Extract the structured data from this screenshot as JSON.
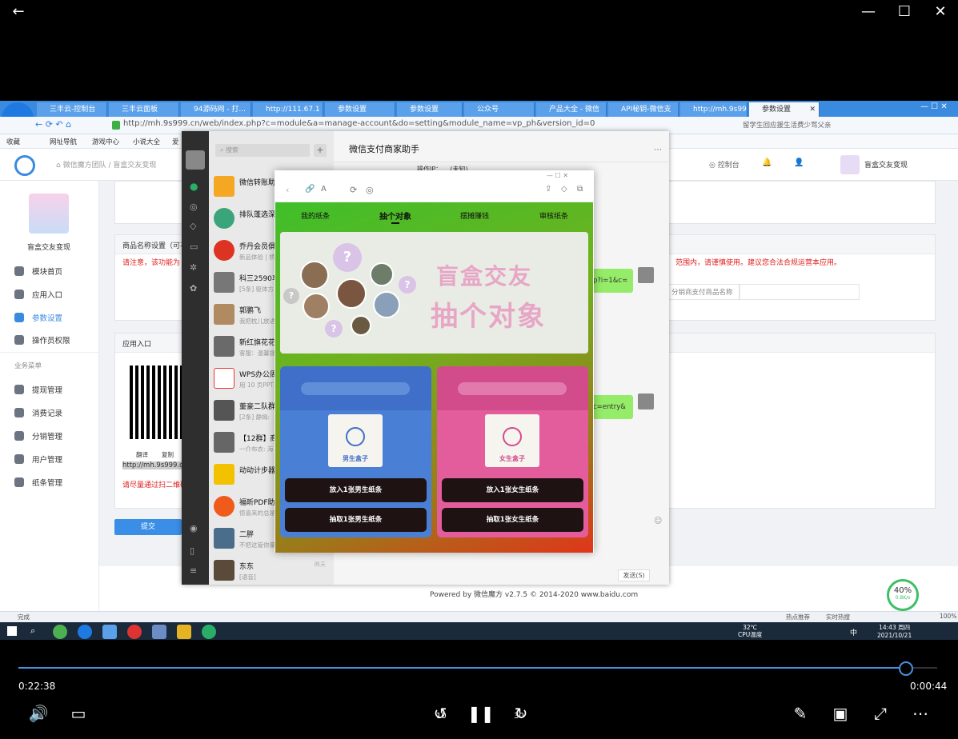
{
  "player": {
    "elapsed": "0:22:38",
    "remaining": "0:00:44",
    "progress": 0.966,
    "rewind_label": "10",
    "forward_label": "30"
  },
  "browser": {
    "tabs": [
      "三丰云-控制台",
      "三丰云面板",
      "94源码网 - 打...",
      "http://111.67.1",
      "参数设置",
      "参数设置",
      "公众号",
      "产品大全 - 微信",
      "API秘钥-微信支",
      "http://mh.9s99",
      "参数设置"
    ],
    "url": "http://mh.9s999.cn/web/index.php?c=module&a=manage-account&do=setting&module_name=vp_ph&version_id=0",
    "bookmarks": [
      "收藏",
      "网址导航",
      "游戏中心",
      "小说大全",
      "爱"
    ],
    "news": "留学生回应援生活费少骂父亲"
  },
  "site": {
    "breadcrumb": "微信魔方团队 / 盲盒交友变现",
    "control_panel": "控制台",
    "account_name": "盲盒交友变现",
    "app_title": "盲盒交友变现",
    "menu": [
      "模块首页",
      "应用入口",
      "参数设置",
      "操作员权限"
    ],
    "business_menu_title": "业务菜单",
    "business_menu": [
      "提现管理",
      "消费记录",
      "分销管理",
      "用户管理",
      "纸条管理"
    ],
    "product_name_title": "商品名称设置（可不",
    "warning": "请注意，该功能为",
    "warning_right": "范围内，请谨慎使用。建议您合法合规运营本应用。",
    "product_input_label": "分销商支付商品名称",
    "entry_title": "应用入口",
    "qr_actions": [
      "翻译",
      "复制"
    ],
    "entry_url": "http://mh.9s999.cn",
    "qr_warning": "请尽量通过扫二维码",
    "submit": "提交",
    "footer": "Powered by 微信魔方 v2.7.5 © 2014-2020 www.baidu.com",
    "status_left": "完成",
    "status_right": [
      "热点推荐",
      "实时热搜",
      "100%"
    ]
  },
  "wechat": {
    "title": "微信支付商家助手",
    "search_placeholder": "搜索",
    "op_ip_label": "操作IP：",
    "op_ip_value": "(未知)",
    "bubble1": "p?i=1&c=",
    "bubble2": "c=entry&",
    "send_button": "发送(S)",
    "chats": [
      {
        "name": "微信转账助",
        "preview": ""
      },
      {
        "name": "排队蓬选深",
        "preview": ""
      },
      {
        "name": "乔丹会员俱",
        "preview": "新品体验 | 桥"
      },
      {
        "name": "科三2590车",
        "preview": "[5条] 驱体方"
      },
      {
        "name": "郭鹏飞",
        "preview": "我把枕儿放进"
      },
      {
        "name": "新红旗花花",
        "preview": "客服：温馨提"
      },
      {
        "name": "WPS办公周",
        "preview": "用 10 页PPT,"
      },
      {
        "name": "董豪二队群",
        "preview": "[2条] 静嫣:"
      },
      {
        "name": "【12群】商",
        "preview": "一介布衣: 海"
      },
      {
        "name": "动动计步器",
        "preview": ""
      },
      {
        "name": "福昕PDF助",
        "preview": "惊喜来的总是"
      },
      {
        "name": "二胖",
        "preview": "不把这管你量"
      },
      {
        "name": "东东",
        "preview": "[语音]"
      }
    ],
    "last_time": "昨天"
  },
  "mini": {
    "tabs": [
      "我的纸条",
      "抽个对象",
      "摆摊赚钱",
      "审核纸条"
    ],
    "banner_line1": "盲盒交友",
    "banner_line2": "抽个对象",
    "male_box": "男生盒子",
    "female_box": "女生盒子",
    "male_put": "放入1张男生纸条",
    "male_draw": "抽取1张男生纸条",
    "female_put": "放入1张女生纸条",
    "female_draw": "抽取1张女生纸条"
  },
  "taskbar": {
    "temp": "32℃",
    "temp_label": "CPU温度",
    "lang": "中",
    "time": "14:43 周四",
    "date": "2021/10/21",
    "gauge": "40%",
    "speed": "0.8K/s"
  },
  "colors": {
    "accent": "#3a8be0",
    "wx_green": "#95ec69",
    "submit": "#3a8ee6"
  }
}
